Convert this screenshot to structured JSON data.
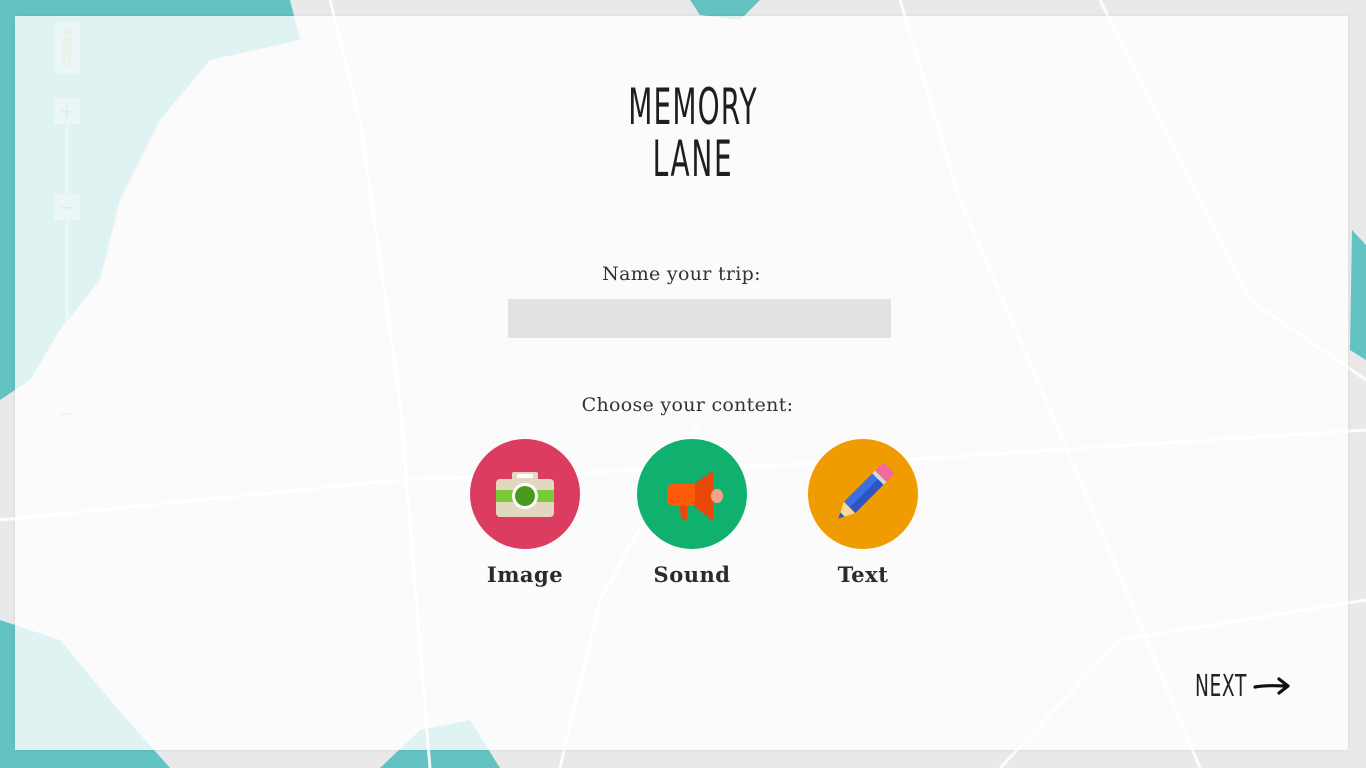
{
  "logo": {
    "line1": "MEMORY",
    "line2": "LANE"
  },
  "trip": {
    "label": "Name your trip:",
    "value": "",
    "placeholder": ""
  },
  "content": {
    "label": "Choose your content:",
    "options": [
      {
        "label": "Image",
        "icon": "camera-icon",
        "color": "#dc3c5f"
      },
      {
        "label": "Sound",
        "icon": "megaphone-icon",
        "color": "#10b16f"
      },
      {
        "label": "Text",
        "icon": "pencil-icon",
        "color": "#f09c00"
      }
    ]
  },
  "next": {
    "label": "NEXT",
    "icon": "arrow-right-icon"
  },
  "map": {
    "water_color": "#63c3c3",
    "land_color": "#e9e9e9",
    "controls": {
      "zoom_in": "+",
      "zoom_out": "−",
      "zoom_out_2": "−"
    }
  }
}
